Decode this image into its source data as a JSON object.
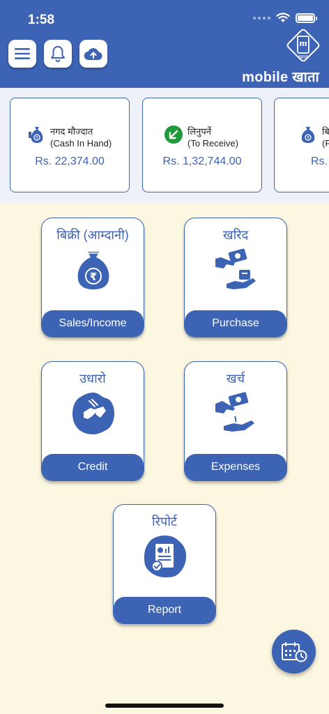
{
  "status": {
    "time": "1:58"
  },
  "brand": {
    "name": "mobile खाता",
    "logo_text": "खाता"
  },
  "summary_cards": [
    {
      "np": "नगद मौज्दात",
      "en": "(Cash In Hand)",
      "amount": "Rs. 22,374.00",
      "icon": "money-bag-icon"
    },
    {
      "np": "लिनुपर्ने",
      "en": "(To Receive)",
      "amount": "Rs. 1,32,744.00",
      "icon": "arrow-down-left-icon"
    },
    {
      "np": "बि",
      "en": "(F",
      "amount": "Rs.",
      "icon": "money-bag-icon"
    }
  ],
  "tiles": {
    "sales": {
      "np": "बिक्री (आम्दानी)",
      "en": "Sales/Income"
    },
    "purchase": {
      "np": "खरिद",
      "en": "Purchase"
    },
    "credit": {
      "np": "उधारो",
      "en": "Credit"
    },
    "expenses": {
      "np": "खर्च",
      "en": "Expenses"
    },
    "report": {
      "np": "रिपोर्ट",
      "en": "Report"
    }
  },
  "colors": {
    "primary": "#3c63b4",
    "background": "#fbf7e0",
    "strip": "#eef1f8",
    "receive_green": "#1f9a3a"
  }
}
